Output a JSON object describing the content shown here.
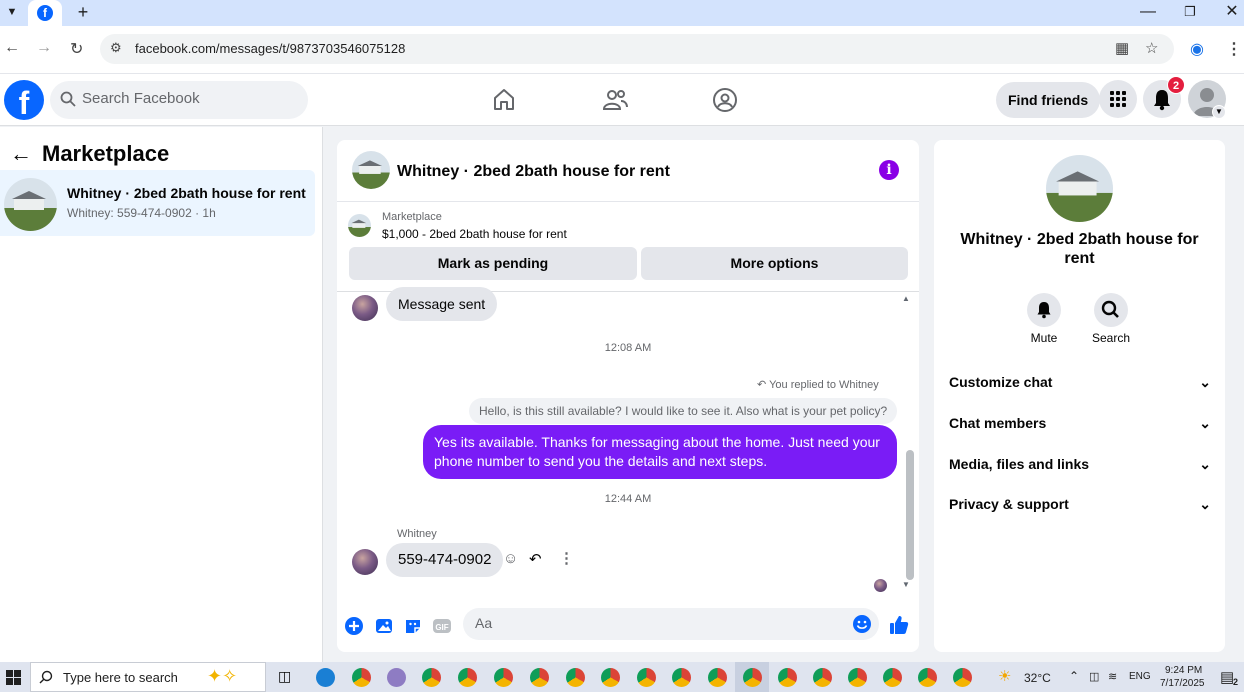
{
  "browser": {
    "url": "facebook.com/messages/t/9873703546075128",
    "icons": [
      "chevron-down-icon",
      "facebook-favicon-icon",
      "new-tab-icon",
      "minimize-icon",
      "maximize-icon",
      "close-icon",
      "back-icon",
      "forward-icon",
      "reload-icon",
      "site-settings-icon",
      "install-icon",
      "star-icon",
      "profile-icon",
      "menu-icon"
    ]
  },
  "header": {
    "search_placeholder": "Search Facebook",
    "find_friends": "Find friends",
    "notification_count": "2"
  },
  "left": {
    "title": "Marketplace",
    "conversation": {
      "name": "Whitney · 2bed 2bath house for rent",
      "preview": "Whitney: 559-474-0902 · 1h"
    }
  },
  "chat": {
    "title": "Whitney · 2bed 2bath house for rent",
    "listing_source": "Marketplace",
    "listing_price": "$1,000 - 2bed 2bath house for rent",
    "btn_pending": "Mark as pending",
    "btn_more": "More options",
    "msg_sent": "Message sent",
    "time1": "12:08 AM",
    "replied_to": "You replied to Whitney",
    "quoted": "Hello, is this still available? I would like to see it. Also what is your pet policy?",
    "outgoing": "Yes its available. Thanks for messaging about the home. Just need your phone number to send you the details and next steps.",
    "time2": "12:44 AM",
    "sender": "Whitney",
    "incoming": "559-474-0902",
    "composer_placeholder": "Aa"
  },
  "right": {
    "name": "Whitney · 2bed 2bath house for rent",
    "mute": "Mute",
    "search": "Search",
    "sections": [
      "Customize chat",
      "Chat members",
      "Media, files and links",
      "Privacy & support"
    ]
  },
  "taskbar": {
    "search_placeholder": "Type here to search",
    "temperature": "32°C",
    "language": "ENG",
    "time": "9:24 PM",
    "date": "7/17/2025",
    "notif_count": "2"
  },
  "colors": {
    "fb_blue": "#0866ff",
    "outgoing_bubble": "#7a1cf6",
    "info_purple": "#8a00e6",
    "badge_red": "#e41e3f"
  }
}
